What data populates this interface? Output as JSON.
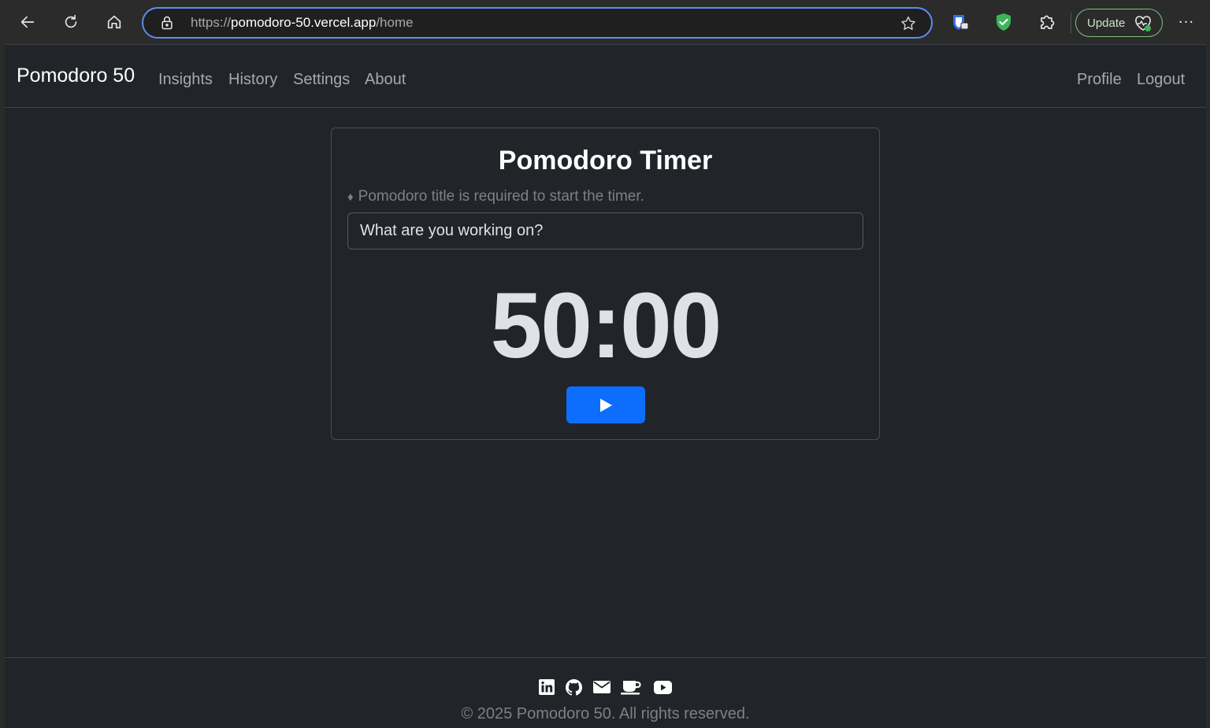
{
  "browser": {
    "url_prefix": "https://",
    "url_host": "pomodoro-50.vercel.app",
    "url_path": "/home",
    "update_label": "Update",
    "more_label": "···",
    "icons": [
      "back-icon",
      "refresh-icon",
      "home-icon",
      "lock-icon",
      "star-icon",
      "extension-shield-icon",
      "extension-shield-check-icon",
      "puzzle-icon",
      "heart-pulse-icon",
      "more-icon"
    ]
  },
  "navbar": {
    "brand": "Pomodoro 50",
    "links": [
      "Insights",
      "History",
      "Settings",
      "About"
    ],
    "right_links": [
      "Profile",
      "Logout"
    ]
  },
  "timer_card": {
    "title": "Pomodoro Timer",
    "hint": "Pomodoro title is required to start the timer.",
    "hint_icon": "diamond-icon",
    "input_placeholder": "What are you working on?",
    "input_value": "",
    "time": "50:00",
    "play_icon": "play-icon"
  },
  "footer": {
    "social_icons": [
      "linkedin-icon",
      "github-icon",
      "email-icon",
      "coffee-icon",
      "youtube-icon"
    ],
    "copyright": "© 2025 Pomodoro 50. All rights reserved."
  },
  "colors": {
    "page_bg": "#212529",
    "chrome_bg": "#2b2b2b",
    "accent": "#0d6efd",
    "url_focus": "#5b8def",
    "muted_text": "#7d8187",
    "update_border": "#7ec082"
  }
}
